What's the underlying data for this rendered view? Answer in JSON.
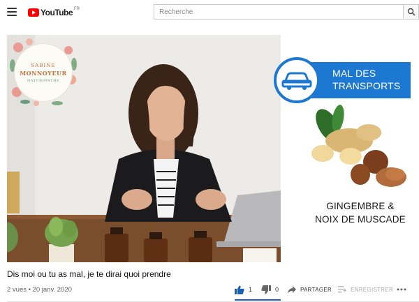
{
  "header": {
    "logo_text": "YouTube",
    "logo_country": "FR",
    "search_placeholder": "Recherche"
  },
  "video": {
    "brand": {
      "name_line1": "SABINE",
      "name_line2": "MONNOYEUR",
      "subtitle": "NATUROPATHE"
    },
    "banner_text": "MAL DES TRANSPORTS",
    "product_caption_line1": "GINGEMBRE &",
    "product_caption_line2": "NOIX DE MUSCADE"
  },
  "info": {
    "title": "Dis moi ou tu as mal, je te dirai quoi prendre",
    "meta": "2 vues • 20 janv. 2020"
  },
  "actions": {
    "like_count": "1",
    "dislike_count": "0",
    "share_label": "PARTAGER",
    "save_label": "ENREGISTRER"
  },
  "icons": {
    "menu": "hamburger-icon",
    "search": "search-icon",
    "like": "thumb-up-icon",
    "dislike": "thumb-down-icon",
    "share": "share-icon",
    "save": "playlist-add-icon",
    "more": "more-horizontal-icon",
    "transport": "car-icon"
  },
  "colors": {
    "youtube_red": "#ff0000",
    "banner_blue": "#1d78d1",
    "like_active": "#1a5fb4"
  }
}
